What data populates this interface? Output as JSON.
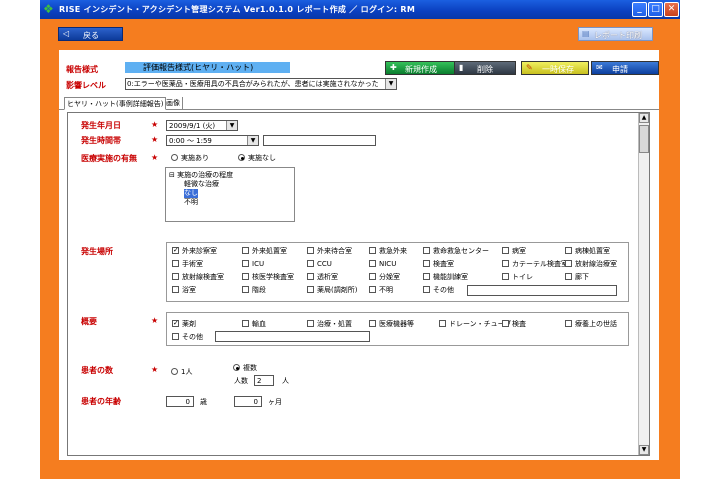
{
  "window": {
    "title": "RISE インシデント・アクシデント管理システム  Ver1.0.1.0    レポート作成    ／    ログイン: RM",
    "buttons": {
      "minimize": "_",
      "maximize": "□",
      "close": "✕"
    }
  },
  "toolbar": {
    "back_label": "戻る",
    "report_print_label": "レポート印刷"
  },
  "header": {
    "report_format_label": "報告様式",
    "report_format_value": "評価報告様式(ヒヤリ・ハット)",
    "severity_label": "影響レベル",
    "severity_value": "0:エラーや医薬品・医療用具の不具合がみられたが、患者には実施されなかった"
  },
  "actions": {
    "new_label": "新規作成",
    "delete_label": "削除",
    "temp_save_label": "一時保存",
    "apply_label": "申請"
  },
  "tabs": [
    {
      "label": "ヒヤリ・ハット(事例詳細報告)"
    },
    {
      "label": "画像"
    }
  ],
  "form": {
    "date": {
      "label": "発生年月日",
      "value": "2009/9/1 (火)"
    },
    "time": {
      "label": "発生時間帯",
      "value": "0:00 ～ 1:59"
    },
    "treatment": {
      "label": "医療実施の有無",
      "options": [
        {
          "label": "実施あり",
          "selected": false
        },
        {
          "label": "実施なし",
          "selected": true
        }
      ],
      "tree": {
        "root": "実施の治療の程度",
        "children": [
          "軽微な治療",
          "なし",
          "不明"
        ],
        "selected": "なし"
      }
    },
    "location": {
      "label": "発生場所",
      "options": [
        {
          "label": "外来診察室",
          "checked": true
        },
        {
          "label": "外来処置室",
          "checked": false
        },
        {
          "label": "外来待合室",
          "checked": false
        },
        {
          "label": "救急外来",
          "checked": false
        },
        {
          "label": "救命救急センター",
          "checked": false
        },
        {
          "label": "病室",
          "checked": false
        },
        {
          "label": "病棟処置室",
          "checked": false
        },
        {
          "label": "手術室",
          "checked": false
        },
        {
          "label": "ICU",
          "checked": false
        },
        {
          "label": "CCU",
          "checked": false
        },
        {
          "label": "NICU",
          "checked": false
        },
        {
          "label": "検査室",
          "checked": false
        },
        {
          "label": "カテーテル検査室",
          "checked": false
        },
        {
          "label": "放射線治療室",
          "checked": false
        },
        {
          "label": "放射線検査室",
          "checked": false
        },
        {
          "label": "核医学検査室",
          "checked": false
        },
        {
          "label": "透析室",
          "checked": false
        },
        {
          "label": "分娩室",
          "checked": false
        },
        {
          "label": "機能訓練室",
          "checked": false
        },
        {
          "label": "トイレ",
          "checked": false
        },
        {
          "label": "廊下",
          "checked": false
        },
        {
          "label": "浴室",
          "checked": false
        },
        {
          "label": "階段",
          "checked": false
        },
        {
          "label": "薬局(調剤所)",
          "checked": false
        },
        {
          "label": "不明",
          "checked": false
        },
        {
          "label": "その他",
          "checked": false
        }
      ]
    },
    "summary": {
      "label": "概要",
      "options": [
        {
          "label": "薬剤",
          "checked": true
        },
        {
          "label": "輸血",
          "checked": false
        },
        {
          "label": "治療・処置",
          "checked": false
        },
        {
          "label": "医療機器等",
          "checked": false
        },
        {
          "label": "ドレーン・チューブ",
          "checked": false
        },
        {
          "label": "検査",
          "checked": false
        },
        {
          "label": "療養上の世話",
          "checked": false
        },
        {
          "label": "その他",
          "checked": false
        }
      ]
    },
    "patients": {
      "label": "患者の数",
      "options": [
        {
          "label": "1人",
          "selected": false
        },
        {
          "label": "複数",
          "selected": true
        }
      ],
      "count_label": "人数",
      "count_value": "2",
      "unit": "人"
    },
    "age": {
      "label": "患者の年齢",
      "years_value": "0",
      "years_unit": "歳",
      "months_value": "0",
      "months_unit": "ヶ月"
    }
  },
  "colors": {
    "frame": "#f57d1f",
    "titlebar": "#0a3fbf",
    "label_red": "#c80000",
    "format_highlight": "#5fb0f2"
  }
}
